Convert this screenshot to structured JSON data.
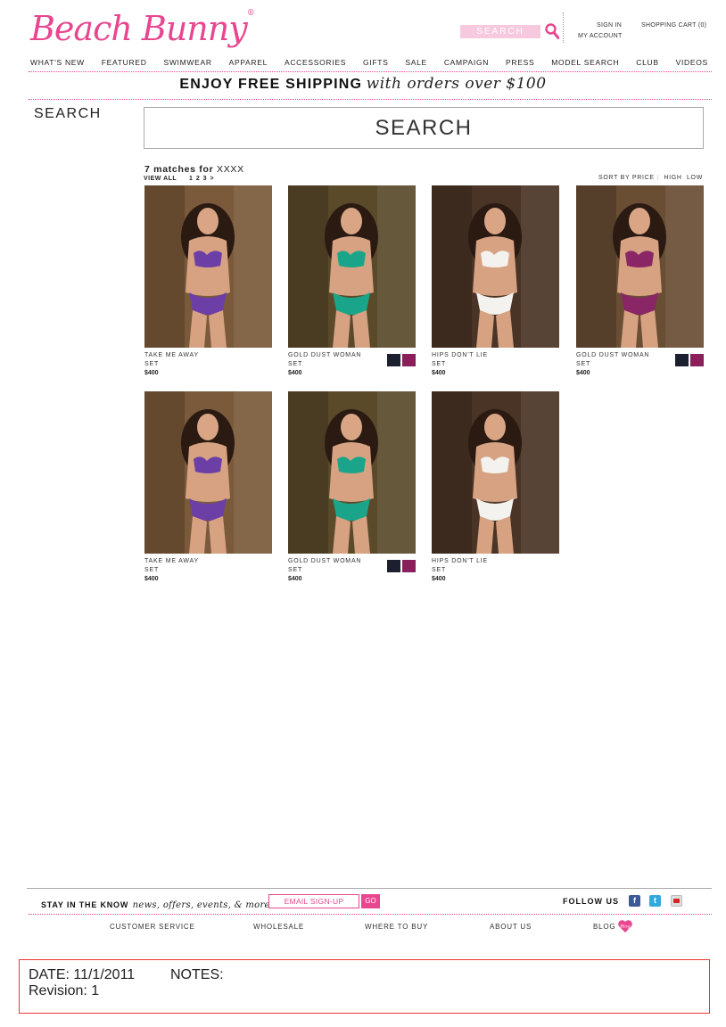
{
  "header": {
    "logo": "Beach Bunny",
    "logo_mark": "®",
    "search_placeholder": "SEARCH",
    "sign_in": "SIGN IN",
    "shopping_cart": "SHOPPING CART (0)",
    "my_account": "MY ACCOUNT"
  },
  "nav": [
    "WHAT'S NEW",
    "FEATURED",
    "SWIMWEAR",
    "APPAREL",
    "ACCESSORIES",
    "GIFTS",
    "SALE",
    "CAMPAIGN",
    "PRESS",
    "MODEL SEARCH",
    "CLUB",
    "VIDEOS"
  ],
  "promo": {
    "bold": "ENJOY FREE SHIPPING",
    "italic": "with orders over $100"
  },
  "sidebar": {
    "title": "SEARCH"
  },
  "search": {
    "value": "SEARCH"
  },
  "results": {
    "count": "7 matches for",
    "query": "XXXX",
    "view_all": "VIEW ALL",
    "pages": "1 2 3 >",
    "sort_label": "SORT BY PRICE :",
    "sort_high": "HIGH",
    "sort_low": "LOW"
  },
  "products": [
    {
      "name": "TAKE ME AWAY",
      "type": "SET",
      "price": "$400",
      "bg": "#7a5a3a",
      "suit": "#6b3fa6",
      "swatches": []
    },
    {
      "name": "GOLD DUST WOMAN",
      "type": "SET",
      "price": "$400",
      "bg": "#5a4a2a",
      "suit": "#1aa58a",
      "swatches": [
        "#1b1f2e",
        "#8a1f5c"
      ]
    },
    {
      "name": "HIPS DON'T LIE",
      "type": "SET",
      "price": "$400",
      "bg": "#4a3426",
      "suit": "#f4f2ef",
      "swatches": []
    },
    {
      "name": "GOLD DUST WOMAN",
      "type": "SET",
      "price": "$400",
      "bg": "#6a4e34",
      "suit": "#8a2566",
      "swatches": [
        "#1b1f2e",
        "#8a1f5c"
      ]
    },
    {
      "name": "TAKE ME AWAY",
      "type": "SET",
      "price": "$400",
      "bg": "#7a5a3a",
      "suit": "#6b3fa6",
      "swatches": []
    },
    {
      "name": "GOLD DUST WOMAN",
      "type": "SET",
      "price": "$400",
      "bg": "#5a4a2a",
      "suit": "#1aa58a",
      "swatches": [
        "#1b1f2e",
        "#8a1f5c"
      ]
    },
    {
      "name": "HIPS DON'T LIE",
      "type": "SET",
      "price": "$400",
      "bg": "#4a3426",
      "suit": "#f4f2ef",
      "swatches": []
    }
  ],
  "footer": {
    "stay_bold": "STAY IN THE KNOW",
    "stay_italic": "news, offers, events, & more",
    "email_placeholder": "EMAIL SIGN-UP",
    "go": "GO",
    "follow": "FOLLOW US",
    "links": [
      "CUSTOMER SERVICE",
      "WHOLESALE",
      "WHERE TO BUY",
      "ABOUT US",
      "BLOG"
    ],
    "blog_badge": "Blog"
  },
  "notes": {
    "date": "DATE: 11/1/2011",
    "label": "NOTES:",
    "revision": "Revision: 1"
  },
  "colors": {
    "brand_pink": "#e8468f",
    "search_pink": "#f6c9de",
    "notes_red": "#e33333"
  }
}
